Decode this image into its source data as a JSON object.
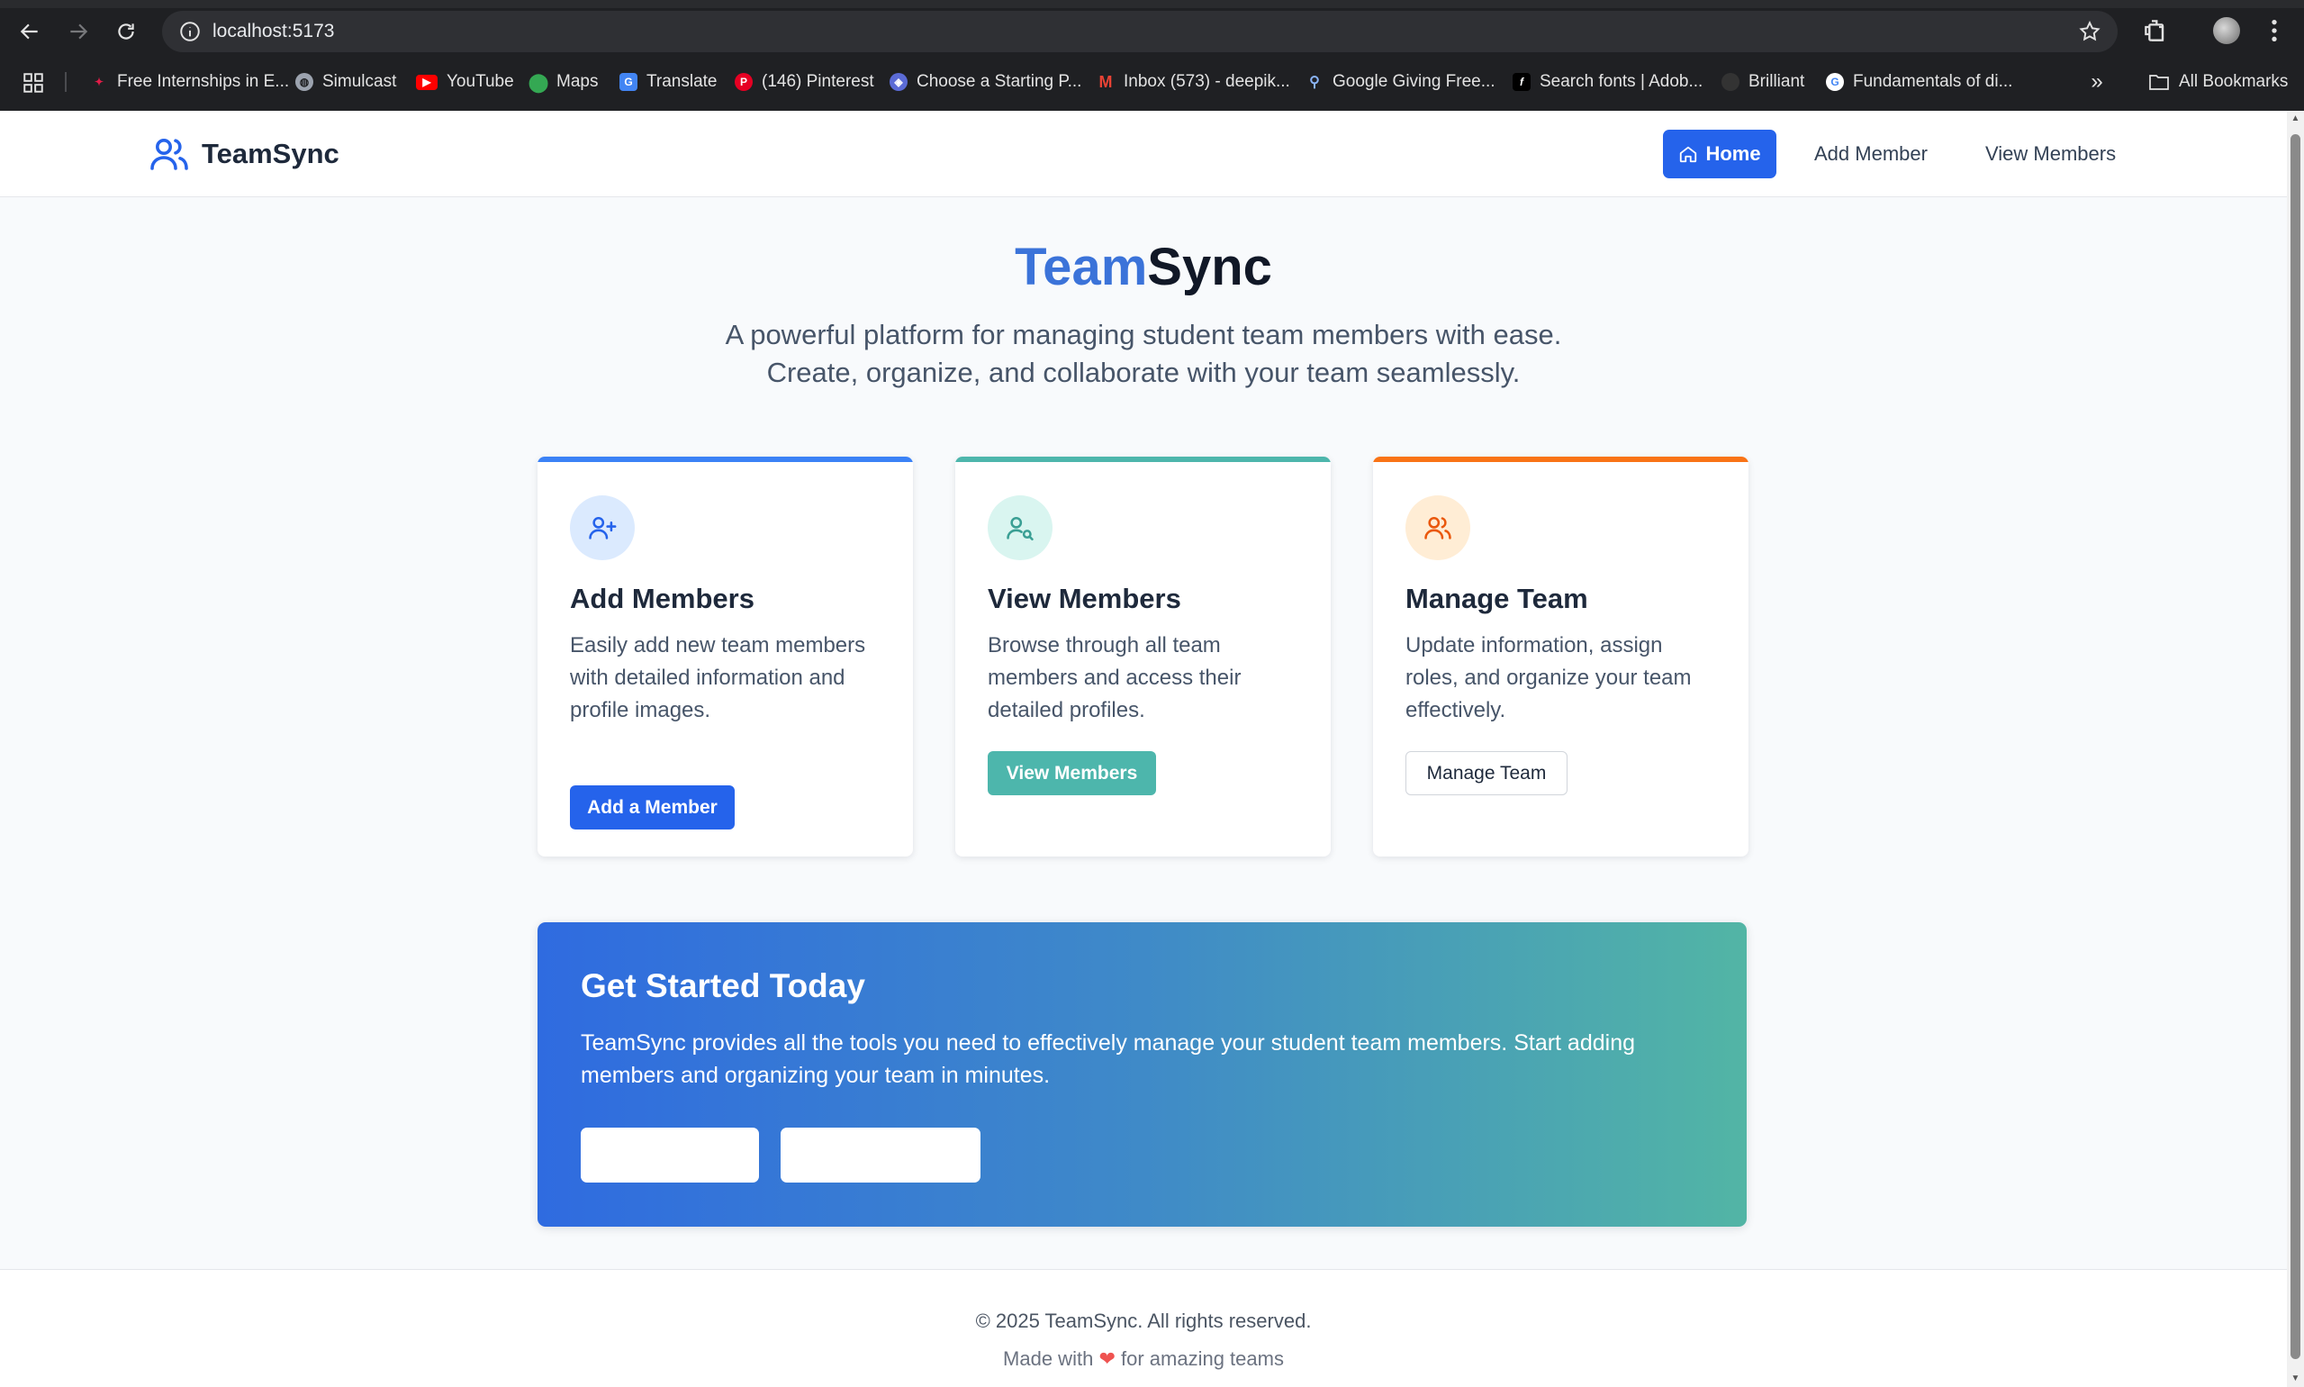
{
  "browser": {
    "url": "localhost:5173",
    "bookmarks": [
      {
        "label": "Free Internships in E...",
        "icon": "sparkle-icon",
        "color": "#e11d48"
      },
      {
        "label": "Simulcast",
        "icon": "globe-icon",
        "color": "#9ca3af"
      },
      {
        "label": "YouTube",
        "icon": "youtube-icon",
        "color": "#ff0000"
      },
      {
        "label": "Maps",
        "icon": "maps-pin-icon",
        "color": "#34a853"
      },
      {
        "label": "Translate",
        "icon": "translate-icon",
        "color": "#4285f4"
      },
      {
        "label": "(146) Pinterest",
        "icon": "pinterest-icon",
        "color": "#e60023"
      },
      {
        "label": "Choose a Starting P...",
        "icon": "shield-icon",
        "color": "#5b6bd6"
      },
      {
        "label": "Inbox (573) - deepik...",
        "icon": "gmail-icon",
        "color": "#ea4335"
      },
      {
        "label": "Google Giving Free...",
        "icon": "google-search-icon",
        "color": "#8ab4f8"
      },
      {
        "label": "Search fonts | Adob...",
        "icon": "font-f-icon",
        "color": "#000000"
      },
      {
        "label": "Brilliant",
        "icon": "brilliant-icon",
        "color": "#333333"
      },
      {
        "label": "Fundamentals of di...",
        "icon": "google-icon",
        "color": "#ffffff"
      }
    ],
    "all_bookmarks_label": "All Bookmarks"
  },
  "header": {
    "brand": "TeamSync",
    "nav": {
      "home": "Home",
      "add_member": "Add Member",
      "view_members": "View Members"
    }
  },
  "hero": {
    "title_accent": "Team",
    "title_rest": "Sync",
    "subtitle_line1": "A powerful platform for managing student team members with ease.",
    "subtitle_line2": "Create, organize, and collaborate with your team seamlessly."
  },
  "cards": [
    {
      "title": "Add Members",
      "description": "Easily add new team members with detailed information and profile images.",
      "button": "Add a Member",
      "accent": "#3b82f6",
      "icon": "user-plus-icon"
    },
    {
      "title": "View Members",
      "description": "Browse through all team members and access their detailed profiles.",
      "button": "View Members",
      "accent": "#4db6ac",
      "icon": "user-search-icon"
    },
    {
      "title": "Manage Team",
      "description": "Update information, assign roles, and organize your team effectively.",
      "button": "Manage Team",
      "accent": "#f97316",
      "icon": "users-icon"
    }
  ],
  "cta": {
    "title": "Get Started Today",
    "text": "TeamSync provides all the tools you need to effectively manage your student team members. Start adding members and organizing your team in minutes.",
    "colors": [
      "#2f6be0",
      "#52b5a5"
    ]
  },
  "footer": {
    "copyright": "© 2025 TeamSync. All rights reserved.",
    "made_before": "Made with",
    "heart": "❤",
    "made_after": "for amazing teams"
  }
}
